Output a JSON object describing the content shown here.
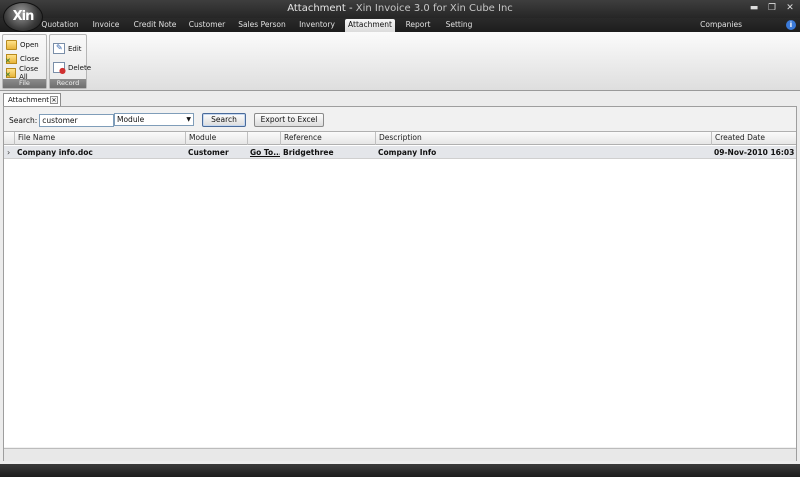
{
  "window": {
    "title_main": "Attachment - ",
    "title_brand": "Xin Invoice 3.0 for Xin Cube Inc",
    "logo_text": "Xin",
    "controls": {
      "minimize": "▬",
      "restore": "❐",
      "close": "✕"
    }
  },
  "menu": {
    "tabs": [
      {
        "label": "Quotation"
      },
      {
        "label": "Invoice"
      },
      {
        "label": "Credit Note"
      },
      {
        "label": "Customer"
      },
      {
        "label": "Sales Person"
      },
      {
        "label": "Inventory"
      },
      {
        "label": "Attachment",
        "active": true
      },
      {
        "label": "Report"
      },
      {
        "label": "Setting"
      }
    ],
    "companies": "Companies",
    "help_icon": "i"
  },
  "ribbon": {
    "file_group": {
      "caption": "File",
      "buttons": [
        {
          "label": "Open",
          "icon": "folder-open-icon"
        },
        {
          "label": "Close",
          "icon": "folder-close-icon"
        },
        {
          "label": "Close All",
          "icon": "folder-close-all-icon"
        }
      ]
    },
    "record_group": {
      "caption": "Record",
      "buttons": [
        {
          "label": "Edit",
          "icon": "edit-icon"
        },
        {
          "label": "Delete",
          "icon": "delete-icon"
        }
      ]
    }
  },
  "document_tab": {
    "label": "Attachment",
    "close": "✕"
  },
  "search": {
    "label": "Search:",
    "value": "customer",
    "field_selected": "Module",
    "search_button": "Search",
    "export_button": "Export to Excel"
  },
  "grid": {
    "columns": [
      "File Name",
      "Module",
      "",
      "Reference",
      "Description",
      "Created Date"
    ],
    "rows": [
      {
        "marker": "›",
        "file_name": "Company info.doc",
        "module": "Customer",
        "goto": "Go To...",
        "reference": "Bridgethree",
        "description": "Company Info",
        "created_date": "09-Nov-2010 16:03"
      }
    ]
  }
}
